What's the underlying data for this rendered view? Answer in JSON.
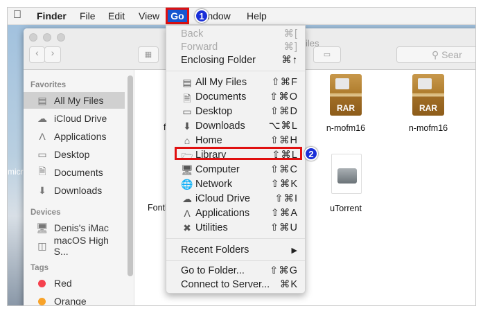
{
  "menubar": {
    "apple_icon": "apple-logo",
    "app": "Finder",
    "items": [
      "File",
      "Edit",
      "View",
      "Go",
      "Window",
      "Help"
    ],
    "window_partial": "ndow"
  },
  "badges": [
    "1",
    "2"
  ],
  "window": {
    "title_partial": "iles",
    "search_placeholder": "Sear"
  },
  "sidebar": {
    "favorites_header": "Favorites",
    "favorites": [
      {
        "label": "All My Files",
        "icon": "all-files-icon",
        "selected": true
      },
      {
        "label": "iCloud Drive",
        "icon": "cloud-icon"
      },
      {
        "label": "Applications",
        "icon": "applications-icon"
      },
      {
        "label": "Desktop",
        "icon": "desktop-icon"
      },
      {
        "label": "Documents",
        "icon": "documents-icon"
      },
      {
        "label": "Downloads",
        "icon": "download-icon"
      }
    ],
    "devices_header": "Devices",
    "devices": [
      {
        "label": "Denis's iMac",
        "icon": "monitor-icon"
      },
      {
        "label": "macOS High S...",
        "icon": "disk-icon"
      }
    ],
    "tags_header": "Tags",
    "tags": [
      {
        "label": "Red",
        "color": "#f5414e"
      },
      {
        "label": "Orange",
        "color": "#f8a32a"
      }
    ]
  },
  "files": [
    {
      "label": "n-mofm16",
      "type": "RAR"
    },
    {
      "label": "n-mofm16",
      "type": "RAR"
    },
    {
      "label": "uTorrent",
      "type": "disk-image"
    },
    {
      "label": "f"
    },
    {
      "label": "Fontl"
    }
  ],
  "desktop_label_partial": "micr",
  "go_menu": {
    "top": [
      {
        "label": "Back",
        "key": "⌘[",
        "disabled": true
      },
      {
        "label": "Forward",
        "key": "⌘]",
        "disabled": true
      },
      {
        "label": "Enclosing Folder",
        "key": "⌘↑"
      }
    ],
    "places": [
      {
        "label": "All My Files",
        "key": "⇧⌘F",
        "icon": "all-files-icon"
      },
      {
        "label": "Documents",
        "key": "⇧⌘O",
        "icon": "documents-icon"
      },
      {
        "label": "Desktop",
        "key": "⇧⌘D",
        "icon": "desktop-icon"
      },
      {
        "label": "Downloads",
        "key": "⌥⌘L",
        "icon": "download-icon"
      },
      {
        "label": "Home",
        "key": "⇧⌘H",
        "icon": "home-icon"
      },
      {
        "label": "Library",
        "key": "⇧⌘L",
        "icon": "folder-icon",
        "highlighted": true
      },
      {
        "label": "Computer",
        "key": "⇧⌘C",
        "icon": "monitor-icon"
      },
      {
        "label": "Network",
        "key": "⇧⌘K",
        "icon": "network-icon"
      },
      {
        "label": "iCloud Drive",
        "key": "⇧⌘I",
        "icon": "cloud-icon"
      },
      {
        "label": "Applications",
        "key": "⇧⌘A",
        "icon": "applications-icon"
      },
      {
        "label": "Utilities",
        "key": "⇧⌘U",
        "icon": "utilities-icon"
      }
    ],
    "recent": "Recent Folders",
    "bottom": [
      {
        "label": "Go to Folder...",
        "key": "⇧⌘G"
      },
      {
        "label": "Connect to Server...",
        "key": "⌘K"
      }
    ]
  },
  "colors": {
    "highlight": "#1657d0",
    "annotation": "#e01010",
    "badge": "#1a2fd8"
  }
}
